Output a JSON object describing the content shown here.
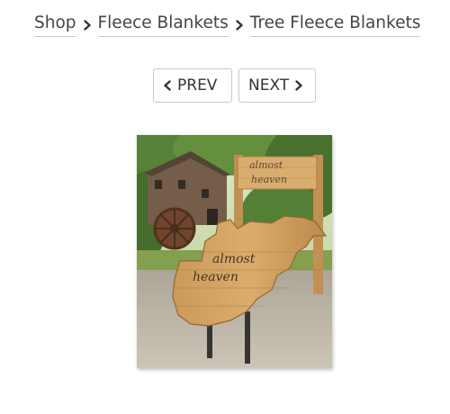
{
  "breadcrumb": {
    "items": [
      {
        "label": "Shop"
      },
      {
        "label": "Fleece Blankets"
      },
      {
        "label": "Tree Fleece Blankets"
      }
    ],
    "separator_icon": "chevron-right-icon"
  },
  "pager": {
    "prev_label": "PREV",
    "next_label": "NEXT",
    "prev_icon": "chevron-left-icon",
    "next_icon": "chevron-right-icon"
  },
  "product": {
    "image_alt": "Tree Fleece Blanket",
    "sign_text_line1": "almost",
    "sign_text_line2": "heaven"
  },
  "colors": {
    "text": "#444444",
    "border": "#c9c9c9",
    "underline": "#c8c8c8"
  }
}
